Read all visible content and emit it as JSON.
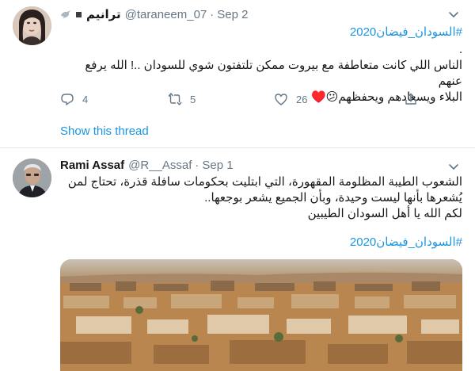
{
  "tweet1": {
    "display_name": "ترانيم",
    "handle": "@taraneem_07",
    "separator": "·",
    "date": "Sep 2",
    "hashtag": "#السودان_فيضان2020",
    "text_lines": [
      ".",
      "الناس اللي كانت متعاطفة مع بيروت ممكن تلتفتون شوي للسودان ..! الله يرفع عنهم",
      "البلاء ويسعادهم ويحفظهم😕♥️"
    ],
    "actions": {
      "replies": "4",
      "retweets": "5",
      "likes": "26"
    },
    "show_thread": "Show this thread"
  },
  "tweet2": {
    "display_name": "Rami Assaf",
    "handle": "@R__Assaf",
    "separator": "·",
    "date": "Sep 1",
    "text_lines": [
      "الشعوب الطيبة المظلومة المقهورة، التي ابتليت بحكومات سافلة قذرة، تحتاج لمن",
      "يُشعرها بأنها ليست وحيدة، وبأن الجميع يشعر بوجعها..",
      "لكم الله يا أهل السودان الطيبين"
    ],
    "hashtag": "#السودان_فيضان2020"
  },
  "icons": [
    "dove-icon",
    "square-icon",
    "chevron-down-icon",
    "reply-icon",
    "retweet-icon",
    "like-icon",
    "share-icon"
  ],
  "colors": {
    "link": "#1b95e0",
    "secondary_text": "#657786",
    "divider": "#e1e8ed",
    "flood_water": "#b8864e"
  }
}
